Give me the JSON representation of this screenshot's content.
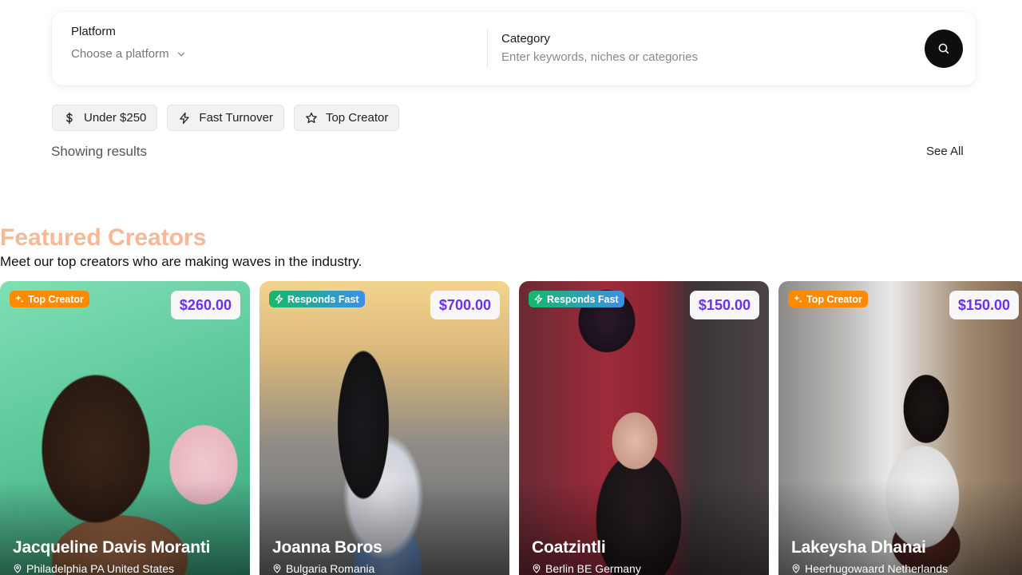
{
  "search": {
    "platform_label": "Platform",
    "platform_value": "Choose a platform",
    "category_label": "Category",
    "category_placeholder": "Enter keywords, niches or categories"
  },
  "chips": [
    {
      "label": "Under $250",
      "icon": "dollar-icon"
    },
    {
      "label": "Fast Turnover",
      "icon": "lightning-icon"
    },
    {
      "label": "Top Creator",
      "icon": "star-icon"
    }
  ],
  "results": {
    "showing": "Showing results",
    "see_all": "See All"
  },
  "featured": {
    "title": "Featured Creators",
    "subtitle": "Meet our top creators who are making waves in the industry."
  },
  "creators": [
    {
      "badge": "Top Creator",
      "badge_type": "top",
      "price": "$260.00",
      "name": "Jacqueline Davis Moranti",
      "location": "Philadelphia PA United States"
    },
    {
      "badge": "Responds Fast",
      "badge_type": "fast",
      "price": "$700.00",
      "name": "Joanna Boros",
      "location": "Bulgaria Romania"
    },
    {
      "badge": "Responds Fast",
      "badge_type": "fast",
      "price": "$150.00",
      "name": "Coatzintli",
      "location": "Berlin BE Germany"
    },
    {
      "badge": "Top Creator",
      "badge_type": "top",
      "price": "$150.00",
      "name": "Lakeysha Dhanai",
      "location": "Heerhugowaard Netherlands"
    }
  ],
  "colors": {
    "accent_title": "#f6b896",
    "price": "#6d2ff0",
    "badge_top": "#ff8a00",
    "search_button": "#0e0e0e"
  }
}
